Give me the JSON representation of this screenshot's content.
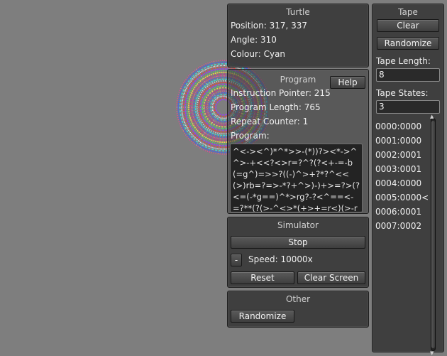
{
  "turtle": {
    "title": "Turtle",
    "position": "Position: 317, 337",
    "angle": "Angle: 310",
    "colour": "Colour: Cyan"
  },
  "program": {
    "title": "Program",
    "help_label": "Help",
    "instruction_pointer": "Instruction Pointer: 215",
    "program_length": "Program Length: 765",
    "repeat_counter": "Repeat Counter: 1",
    "program_label": "Program:",
    "code": "^<-><^)*^*>>-(*))?><*->^^>-+<<?<>r=?^?(?<+-=-b(=g^)=>>?((-)^>+?*?^<<(>)rb=?=>-*?+^>)-)+>=?>(?<=(-*g==)^*>rg?-?<^==<-=?**(?(>-^<>*(+>+=r<)(>-r*-)(g+=><+>+->**g?+>*)r=^++?(?^"
  },
  "simulator": {
    "title": "Simulator",
    "stop_label": "Stop",
    "minus_label": "-",
    "speed_text": "Speed: 10000x",
    "reset_label": "Reset",
    "clear_screen_label": "Clear Screen"
  },
  "other": {
    "title": "Other",
    "randomize_label": "Randomize"
  },
  "tape": {
    "title": "Tape",
    "clear_label": "Clear",
    "randomize_label": "Randomize",
    "length_label": "Tape Length:",
    "length_value": "8",
    "states_label": "Tape States:",
    "states_value": "3",
    "entries": [
      "0000:0000",
      "0001:0000",
      "0002:0001",
      "0003:0001",
      "0004:0000",
      "0005:0000<",
      "0006:0001",
      "0007:0002"
    ]
  },
  "colors": {
    "background": "#7e7e7e",
    "panel": "#3a3a3a"
  }
}
